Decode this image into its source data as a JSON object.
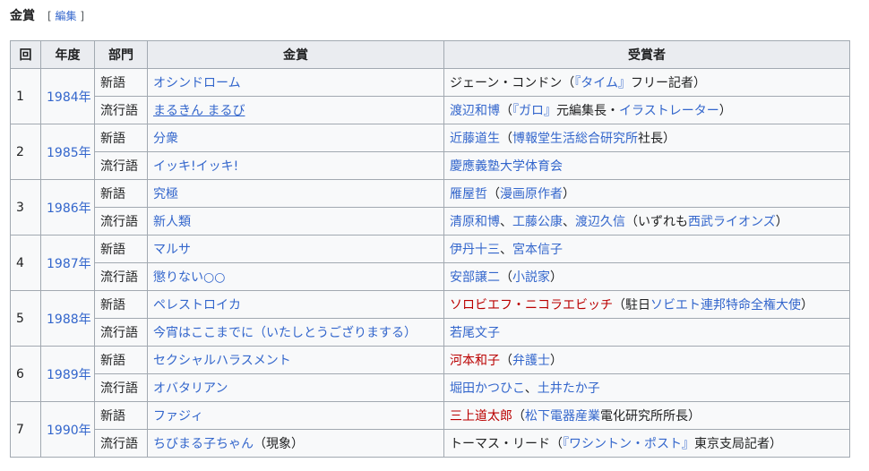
{
  "section": {
    "title": "金賞",
    "edit_open": "[",
    "edit_label": "編集",
    "edit_close": "]"
  },
  "table": {
    "headers": [
      "回",
      "年度",
      "部門",
      "金賞",
      "受賞者"
    ],
    "groups": [
      {
        "num": "1",
        "year": "1984年",
        "rows": [
          {
            "cat": "新語",
            "word": "オシンドローム",
            "recipient": [
              {
                "t": "ジェーン・コンドン（",
                "k": "plain"
              },
              {
                "t": "『タイム』",
                "k": "link"
              },
              {
                "t": "フリー記者）",
                "k": "plain"
              }
            ]
          },
          {
            "cat": "流行語",
            "word": "まるきん まるび",
            "word_underline": true,
            "recipient": [
              {
                "t": "渡辺和博",
                "k": "link"
              },
              {
                "t": "（",
                "k": "plain"
              },
              {
                "t": "『ガロ』",
                "k": "link"
              },
              {
                "t": "元編集長・",
                "k": "plain"
              },
              {
                "t": "イラストレーター",
                "k": "link"
              },
              {
                "t": "）",
                "k": "plain"
              }
            ]
          }
        ]
      },
      {
        "num": "2",
        "year": "1985年",
        "rows": [
          {
            "cat": "新語",
            "word": "分衆",
            "recipient": [
              {
                "t": "近藤道生",
                "k": "link"
              },
              {
                "t": "（",
                "k": "plain"
              },
              {
                "t": "博報堂生活総合研究所",
                "k": "link"
              },
              {
                "t": "社長）",
                "k": "plain"
              }
            ]
          },
          {
            "cat": "流行語",
            "word": "イッキ!イッキ!",
            "recipient": [
              {
                "t": "慶應義塾大学体育会",
                "k": "link"
              }
            ]
          }
        ]
      },
      {
        "num": "3",
        "year": "1986年",
        "rows": [
          {
            "cat": "新語",
            "word": "究極",
            "recipient": [
              {
                "t": "雁屋哲",
                "k": "link"
              },
              {
                "t": "（",
                "k": "plain"
              },
              {
                "t": "漫画原作者",
                "k": "link"
              },
              {
                "t": "）",
                "k": "plain"
              }
            ]
          },
          {
            "cat": "流行語",
            "word": "新人類",
            "recipient": [
              {
                "t": "清原和博",
                "k": "link"
              },
              {
                "t": "、",
                "k": "plain"
              },
              {
                "t": "工藤公康",
                "k": "link"
              },
              {
                "t": "、",
                "k": "plain"
              },
              {
                "t": "渡辺久信",
                "k": "link"
              },
              {
                "t": "（いずれも",
                "k": "plain"
              },
              {
                "t": "西武ライオンズ",
                "k": "link"
              },
              {
                "t": "）",
                "k": "plain"
              }
            ]
          }
        ]
      },
      {
        "num": "4",
        "year": "1987年",
        "rows": [
          {
            "cat": "新語",
            "word": "マルサ",
            "recipient": [
              {
                "t": "伊丹十三",
                "k": "link"
              },
              {
                "t": "、",
                "k": "plain"
              },
              {
                "t": "宮本信子",
                "k": "link"
              }
            ]
          },
          {
            "cat": "流行語",
            "word": "懲りない○○",
            "recipient": [
              {
                "t": "安部譲二",
                "k": "link"
              },
              {
                "t": "（",
                "k": "plain"
              },
              {
                "t": "小説家",
                "k": "link"
              },
              {
                "t": "）",
                "k": "plain"
              }
            ]
          }
        ]
      },
      {
        "num": "5",
        "year": "1988年",
        "rows": [
          {
            "cat": "新語",
            "word": "ペレストロイカ",
            "recipient": [
              {
                "t": "ソロビエフ・ニコラエビッチ",
                "k": "red"
              },
              {
                "t": "（駐日",
                "k": "plain"
              },
              {
                "t": "ソビエト連邦特命全権大使",
                "k": "link"
              },
              {
                "t": "）",
                "k": "plain"
              }
            ]
          },
          {
            "cat": "流行語",
            "word": "今宵はここまでに（いたしとうござりまする）",
            "recipient": [
              {
                "t": "若尾文子",
                "k": "link"
              }
            ]
          }
        ]
      },
      {
        "num": "6",
        "year": "1989年",
        "rows": [
          {
            "cat": "新語",
            "word": "セクシャルハラスメント",
            "recipient": [
              {
                "t": "河本和子",
                "k": "red"
              },
              {
                "t": "（",
                "k": "plain"
              },
              {
                "t": "弁護士",
                "k": "link"
              },
              {
                "t": "）",
                "k": "plain"
              }
            ]
          },
          {
            "cat": "流行語",
            "word": "オバタリアン",
            "recipient": [
              {
                "t": "堀田かつひこ",
                "k": "link"
              },
              {
                "t": "、",
                "k": "plain"
              },
              {
                "t": "土井たか子",
                "k": "link"
              }
            ]
          }
        ]
      },
      {
        "num": "7",
        "year": "1990年",
        "rows": [
          {
            "cat": "新語",
            "word": "ファジィ",
            "recipient": [
              {
                "t": "三上道太郎",
                "k": "red"
              },
              {
                "t": "（",
                "k": "plain"
              },
              {
                "t": "松下電器産業",
                "k": "link"
              },
              {
                "t": "電化研究所所長）",
                "k": "plain"
              }
            ]
          },
          {
            "cat": "流行語",
            "word": "ちびまる子ちゃん",
            "word_suffix": "（現象）",
            "recipient": [
              {
                "t": "トーマス・リード（",
                "k": "plain"
              },
              {
                "t": "『ワシントン・ポスト』",
                "k": "link"
              },
              {
                "t": "東京支局記者）",
                "k": "plain"
              }
            ]
          }
        ]
      }
    ]
  },
  "colors": {
    "link": "#3366cc",
    "redlink": "#ba0000",
    "border": "#a2a9b1",
    "header_bg": "#eaecf0",
    "cell_bg": "#f8f9fa"
  }
}
